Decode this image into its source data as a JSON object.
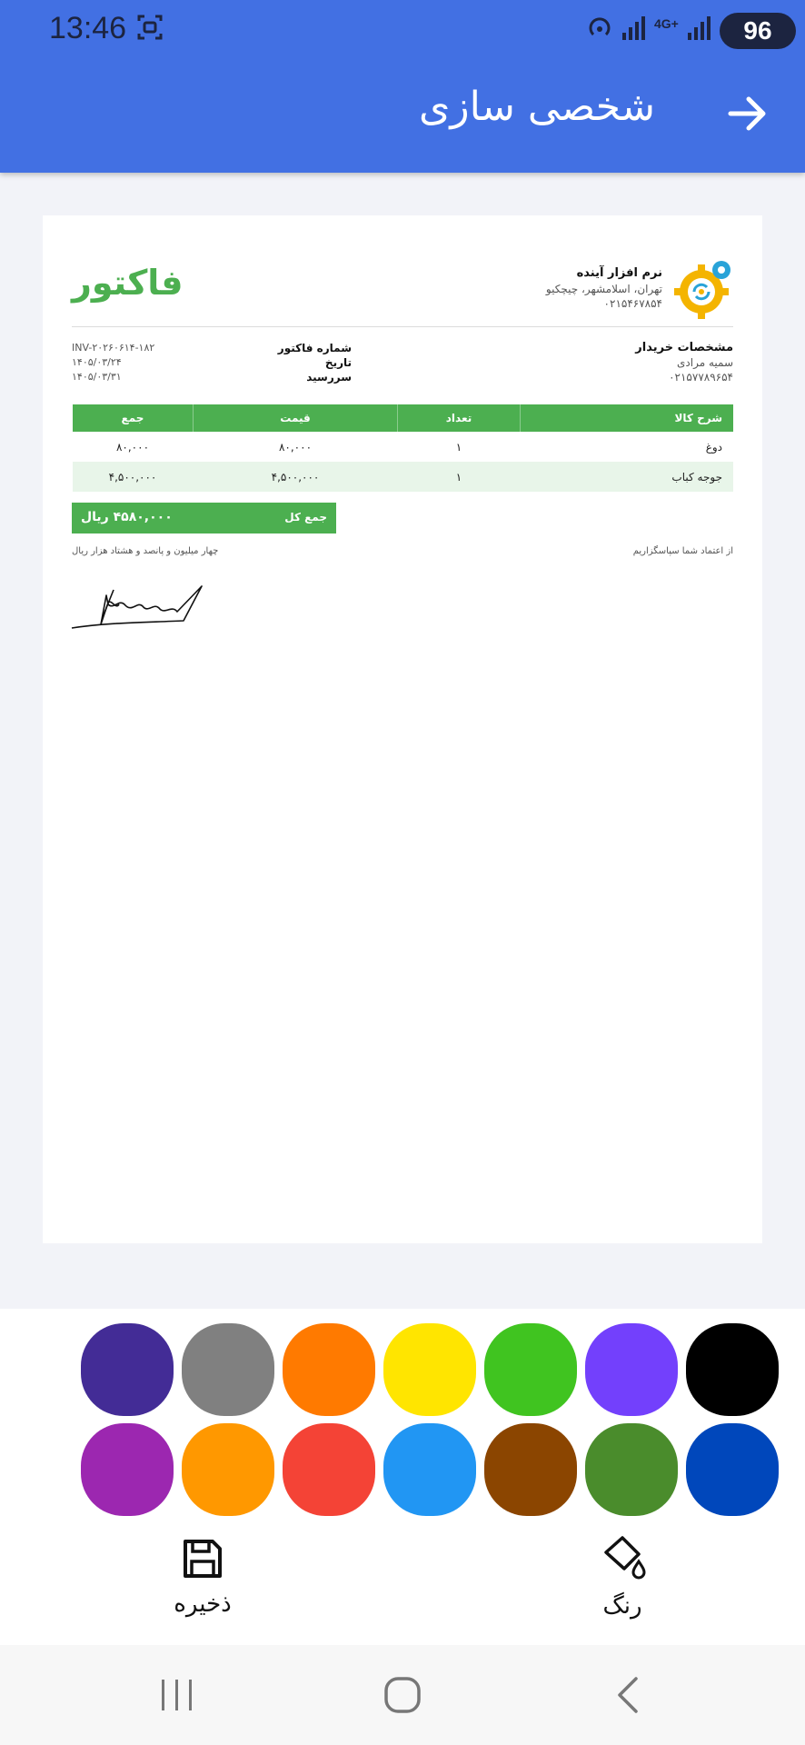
{
  "status_bar": {
    "time": "13:46",
    "network_label": "4G+",
    "battery": "96",
    "icons": [
      "screenshot-icon",
      "hotspot-icon",
      "signal-icon",
      "network-4g-icon",
      "signal-icon-2"
    ]
  },
  "app_bar": {
    "title": "شخصی سازی",
    "back_icon": "arrow-forward-icon",
    "color": "#4270e3"
  },
  "invoice": {
    "title": "فاکتور",
    "company": {
      "name": "نرم افزار آینده",
      "address": "تهران، اسلامشهر، چیچکیو",
      "phone": "۰۲۱۵۴۶۷۸۵۴"
    },
    "buyer": {
      "heading": "مشخصات خریدار",
      "name": "سمیه مرادی",
      "phone": "۰۲۱۵۷۷۸۹۶۵۴"
    },
    "meta": {
      "labels": [
        "شماره فاکتور",
        "تاریخ",
        "سررسید"
      ],
      "values": [
        "INV-۲۰۲۶۰۶۱۴-۱۸۲",
        "۱۴۰۵/۰۳/۲۴",
        "۱۴۰۵/۰۳/۳۱"
      ]
    },
    "table": {
      "headers": [
        "شرح کالا",
        "تعداد",
        "قیمت",
        "جمع"
      ],
      "rows": [
        [
          "دوغ",
          "۱",
          "۸۰,۰۰۰",
          "۸۰,۰۰۰"
        ],
        [
          "جوجه کباب",
          "۱",
          "۴,۵۰۰,۰۰۰",
          "۴,۵۰۰,۰۰۰"
        ]
      ]
    },
    "total": {
      "label": "جمع کل",
      "value": "۴۵۸۰,۰۰۰ ریال"
    },
    "thanks": "از اعتماد شما سپاسگزاریم",
    "amount_words": "چهار میلیون و پانصد و هشتاد هزار ریال",
    "accent_color": "#4caf50"
  },
  "palette": {
    "colors_row1": [
      "#000000",
      "#7340fc",
      "#40c420",
      "#ffe500",
      "#ff7a00",
      "#808080",
      "#432c96"
    ],
    "colors_row2": [
      "#0047bb",
      "#4a8c2c",
      "#8b4500",
      "#2196f3",
      "#f44336",
      "#ff9800",
      "#9c27b0"
    ],
    "color_tool_label": "رنگ",
    "color_tool_icon": "paint-bucket-icon",
    "save_tool_label": "ذخیره",
    "save_tool_icon": "save-icon"
  },
  "nav_bar": {
    "buttons": [
      "recent-apps-icon",
      "home-icon",
      "back-icon"
    ]
  }
}
